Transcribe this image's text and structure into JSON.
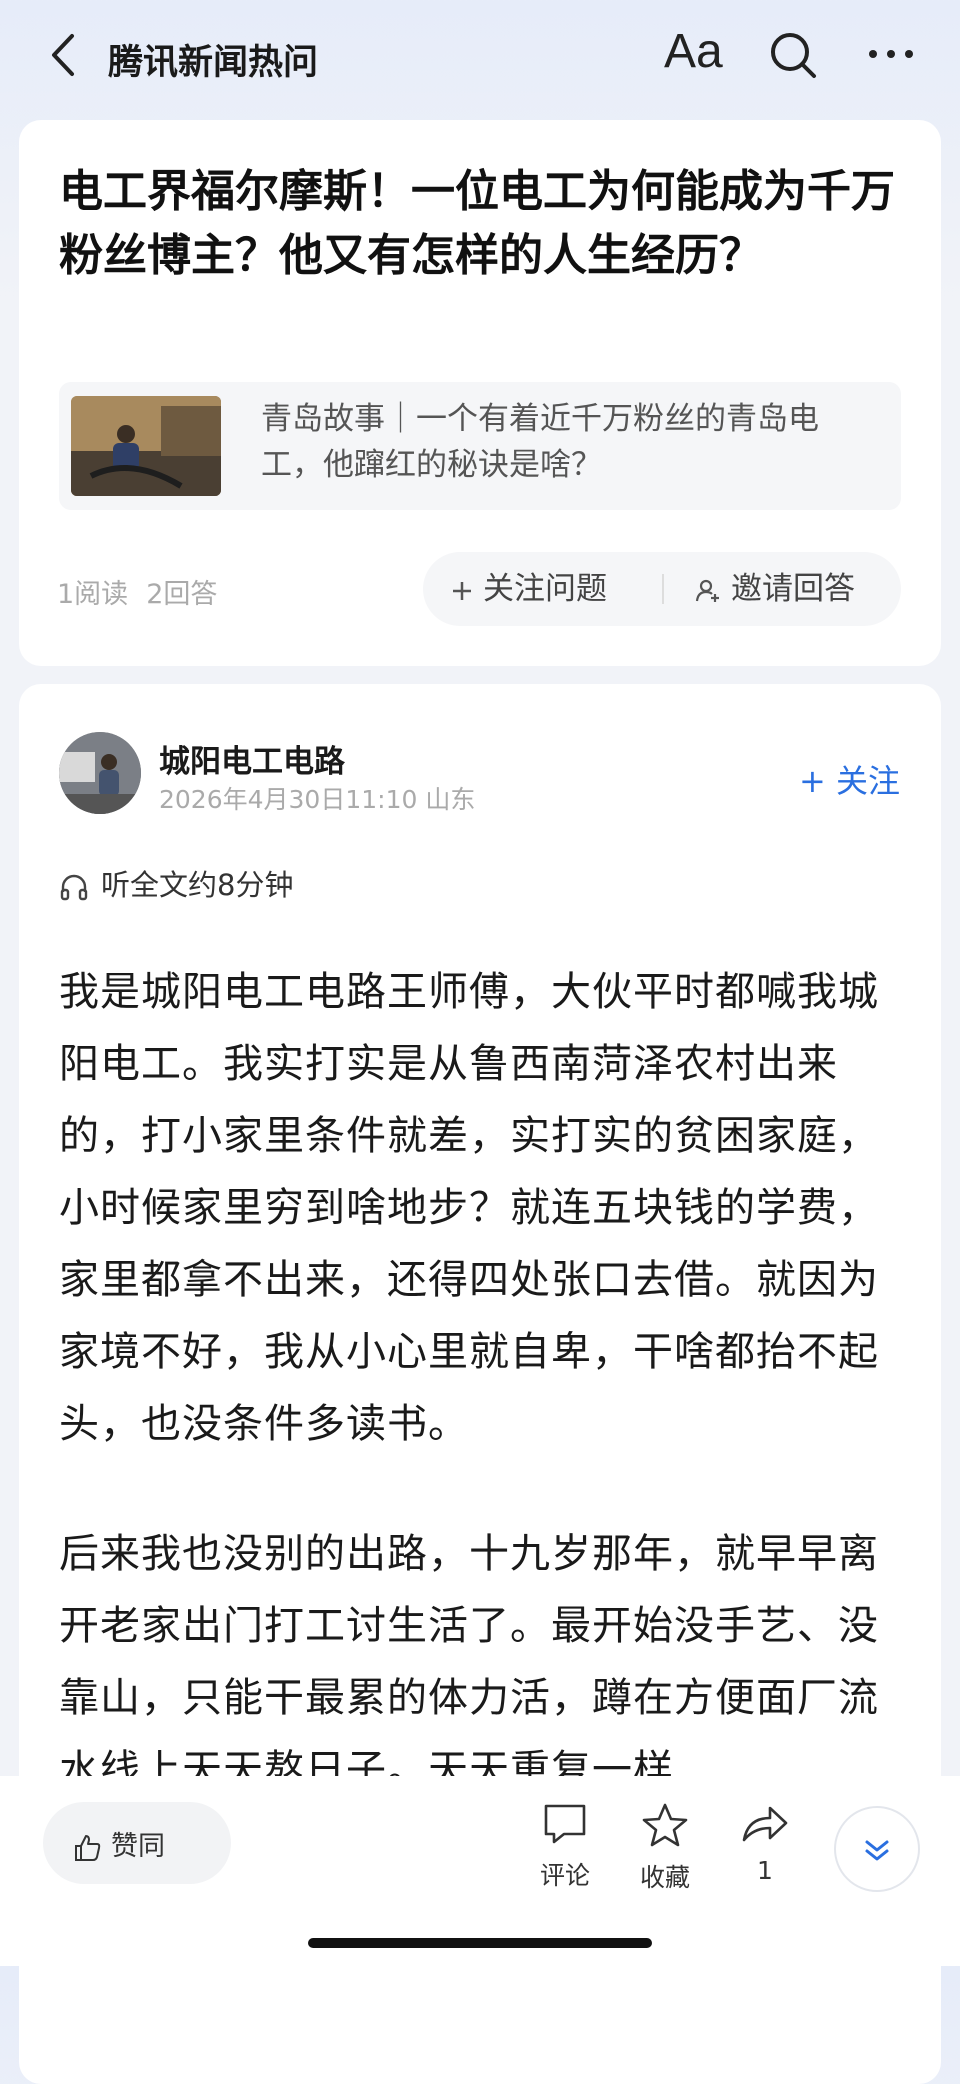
{
  "header": {
    "title": "腾讯新闻热问",
    "font_button": "Aa"
  },
  "question": {
    "title": "电工界福尔摩斯！一位电工为何能成为千万粉丝博主？他又有怎样的人生经历？",
    "reference": "青岛故事｜一个有着近千万粉丝的青岛电工，他蹿红的秘诀是啥？",
    "reads": "1阅读",
    "answers": "2回答",
    "follow_label": "关注问题",
    "invite_label": "邀请回答"
  },
  "answer": {
    "author": "城阳电工电路",
    "meta": "2026年4月30日11:10 山东",
    "follow_label": "+ 关注",
    "listen": "听全文约8分钟",
    "paragraphs": [
      "我是城阳电工电路王师傅，大伙平时都喊我城阳电工。我实打实是从鲁西南菏泽农村出来的，打小家里条件就差，实打实的贫困家庭，小时候家里穷到啥地步？就连五块钱的学费，家里都拿不出来，还得四处张口去借。就因为家境不好，我从小心里就自卑，干啥都抬不起头，也没条件多读书。",
      "后来我也没别的出路，十九岁那年，就早早离开老家出门打工讨生活了。最开始没手艺、没靠山，只能干最累的体力活，蹲在方便面厂流水线上天天熬日子。天天重复一样"
    ]
  },
  "bottom": {
    "like_label": "赞同",
    "comment_label": "评论",
    "collect_label": "收藏",
    "share_count": "1"
  },
  "colors": {
    "accent": "#2a6fe0"
  }
}
